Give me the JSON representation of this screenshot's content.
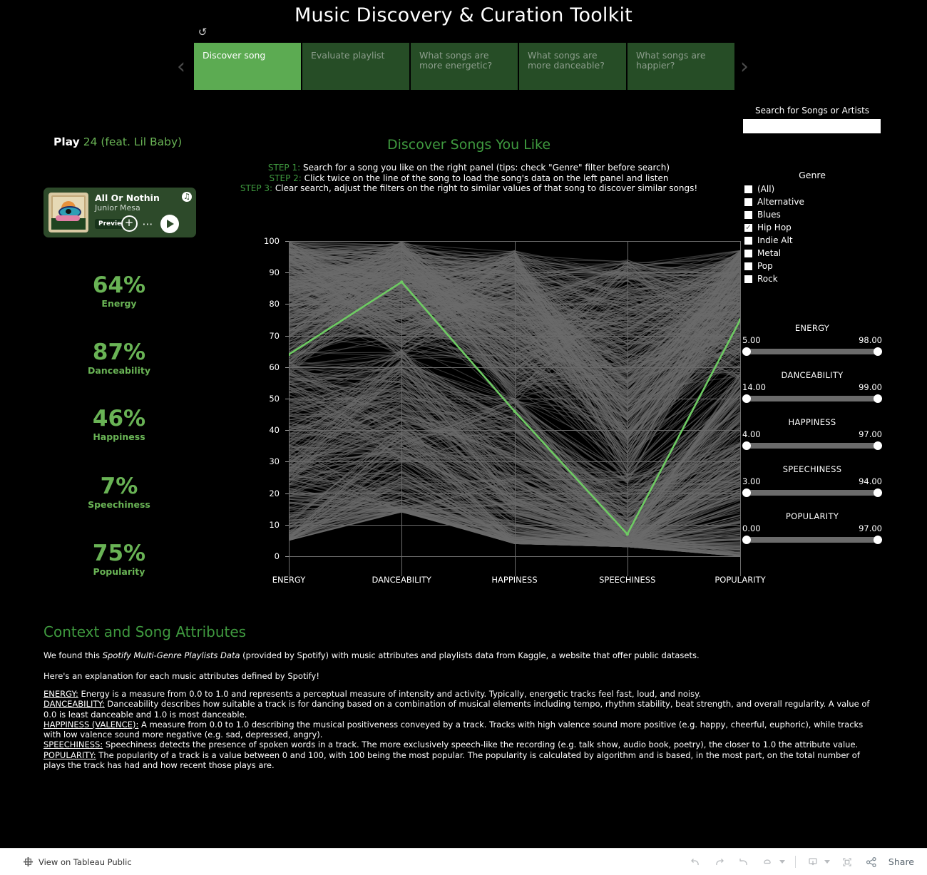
{
  "dashboard": {
    "title": "Music Discovery & Curation Toolkit",
    "reset_icon": "reset-icon",
    "prev_arrow": "‹",
    "next_arrow": "›",
    "tabs": [
      {
        "label": "Discover song",
        "active": true
      },
      {
        "label": "Evaluate playlist",
        "active": false
      },
      {
        "label": "What songs are more energetic?",
        "active": false
      },
      {
        "label": "What songs are more danceable?",
        "active": false
      },
      {
        "label": "What songs are happier?",
        "active": false
      }
    ]
  },
  "left_panel": {
    "play_word": "Play",
    "song_name": "24 (feat. Lil Baby)",
    "spotify_card": {
      "track": "All Or Nothin",
      "artist": "Junior Mesa",
      "preview_label": "Preview",
      "add_icon": "plus-circle-icon",
      "more_icon": "more-options-icon",
      "play_icon": "play-icon",
      "brand_icon": "spotify-icon"
    },
    "stats": [
      {
        "value": "64%",
        "label": "Energy"
      },
      {
        "value": "87%",
        "label": "Danceability"
      },
      {
        "value": "46%",
        "label": "Happiness"
      },
      {
        "value": "7%",
        "label": "Speechiness"
      },
      {
        "value": "75%",
        "label": "Popularity"
      }
    ]
  },
  "chart_panel": {
    "title": "Discover Songs You Like",
    "steps": [
      {
        "key": "STEP 1:",
        "text": " Search for a song you like on the right panel (tips: check \"Genre\" filter before search)"
      },
      {
        "key": "STEP 2:",
        "text": " Click twice on the line of the song to load the song's data on the left panel and listen"
      },
      {
        "key": "STEP 3:",
        "text": " Clear search, adjust the filters on the right to similar values of that song to discover similar songs!"
      }
    ]
  },
  "chart_data": {
    "type": "line",
    "title": "Discover Songs You Like",
    "xlabel": "",
    "ylabel": "",
    "ylim": [
      0,
      100
    ],
    "grid": true,
    "legend": "none",
    "categories": [
      "ENERGY",
      "DANCEABILITY",
      "HAPPINESS",
      "SPEECHINESS",
      "POPULARITY"
    ],
    "yticks": [
      0,
      10,
      20,
      30,
      40,
      50,
      60,
      70,
      80,
      90,
      100
    ],
    "highlight_color": "#6ecb63",
    "background_series_color": "#6b6b6b",
    "series": [
      {
        "name": "24 (feat. Lil Baby)",
        "highlight": true,
        "values": [
          64,
          87,
          46,
          7,
          75
        ]
      }
    ],
    "background_envelope": {
      "note": "Dense grey parallel-coordinates bundle of all Hip Hop tracks",
      "upper": [
        100,
        100,
        97,
        94,
        97
      ],
      "lower": [
        5,
        14,
        4,
        3,
        0
      ]
    }
  },
  "right_panel": {
    "search_label": "Search for Songs or Artists",
    "search_value": "",
    "search_placeholder": "",
    "genre_title": "Genre",
    "genres": [
      {
        "label": "(All)",
        "checked": false
      },
      {
        "label": "Alternative",
        "checked": false
      },
      {
        "label": "Blues",
        "checked": false
      },
      {
        "label": "Hip Hop",
        "checked": true
      },
      {
        "label": "Indie Alt",
        "checked": false
      },
      {
        "label": "Metal",
        "checked": false
      },
      {
        "label": "Pop",
        "checked": false
      },
      {
        "label": "Rock",
        "checked": false
      }
    ],
    "sliders": [
      {
        "name": "ENERGY",
        "min": "5.00",
        "max": "98.00"
      },
      {
        "name": "DANCEABILITY",
        "min": "14.00",
        "max": "99.00"
      },
      {
        "name": "HAPPINESS",
        "min": "4.00",
        "max": "97.00"
      },
      {
        "name": "SPEECHINESS",
        "min": "3.00",
        "max": "94.00"
      },
      {
        "name": "POPULARITY",
        "min": "0.00",
        "max": "97.00"
      }
    ]
  },
  "context": {
    "heading": "Context and Song Attributes",
    "p1_a": "We found this ",
    "p1_i": "Spotify Multi-Genre Playlists Data",
    "p1_b": " (provided by Spotify) with music attributes and playlists data from Kaggle, a website that offer public datasets.",
    "p2": "Here's an explanation for each music attributes defined by Spotify!",
    "definitions": [
      {
        "term": "ENERGY:",
        "text": " Energy is a measure from 0.0 to 1.0 and represents a perceptual measure of intensity and activity. Typically, energetic tracks feel fast, loud, and noisy."
      },
      {
        "term": "DANCEABILITY:",
        "text": " Danceability describes how suitable a track is for dancing based on a combination of musical elements including tempo, rhythm stability, beat strength, and overall regularity. A value of 0.0 is least danceable and 1.0 is most danceable."
      },
      {
        "term": "HAPPINESS (VALENCE):",
        "text": " A measure from 0.0 to 1.0 describing the musical positiveness conveyed by a track. Tracks with high valence sound more positive (e.g. happy, cheerful, euphoric), while tracks with low valence sound more negative (e.g. sad, depressed, angry)."
      },
      {
        "term": "SPEECHINESS:",
        "text": " Speechiness detects the presence of spoken words in a track. The more exclusively speech-like the recording (e.g. talk show, audio book, poetry), the closer to 1.0 the attribute value."
      },
      {
        "term": "POPULARITY:",
        "text": " The popularity of a track is a value between 0 and 100, with 100 being the most popular. The popularity is calculated by algorithm and is based, in the most part, on the total number of plays the track has had and how recent those plays are."
      }
    ]
  },
  "bottom_bar": {
    "view_label": "View on Tableau Public",
    "share_label": "Share",
    "icons": [
      "undo-icon",
      "redo-icon",
      "revert-icon",
      "refresh-icon",
      "pause-dropdown-icon",
      "download-icon",
      "fullscreen-icon",
      "share-icon"
    ]
  }
}
